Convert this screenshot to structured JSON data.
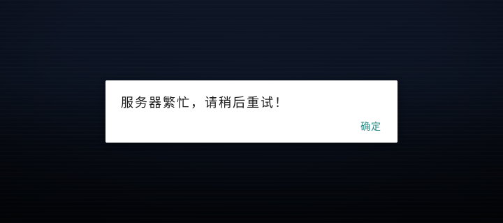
{
  "dialog": {
    "message": "服务器繁忙，请稍后重试！",
    "confirm_label": "确定"
  },
  "colors": {
    "background_top": "#0d1424",
    "background_bottom": "#020408",
    "dialog_bg": "#ffffff",
    "message_text": "#1d1d1d",
    "confirm_text": "#2d8b86"
  }
}
